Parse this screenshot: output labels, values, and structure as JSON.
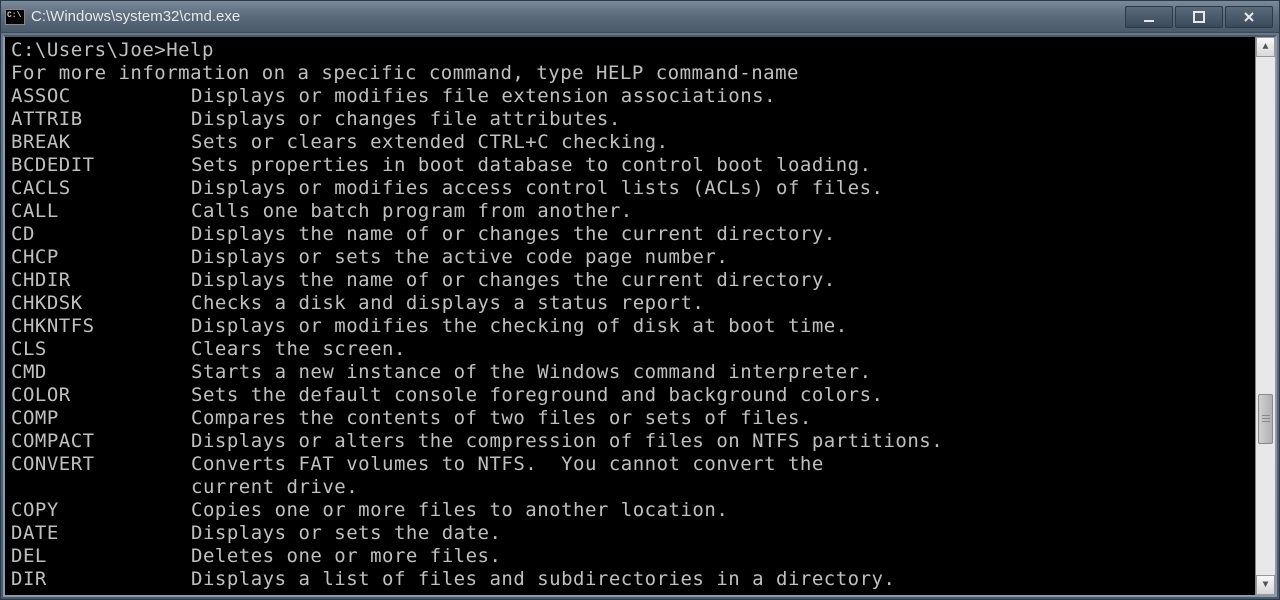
{
  "window": {
    "title": "C:\\Windows\\system32\\cmd.exe"
  },
  "console": {
    "prompt": "C:\\Users\\Joe>",
    "typed_command": "Help",
    "intro": "For more information on a specific command, type HELP command-name",
    "commands": [
      {
        "name": "ASSOC",
        "desc": "Displays or modifies file extension associations."
      },
      {
        "name": "ATTRIB",
        "desc": "Displays or changes file attributes."
      },
      {
        "name": "BREAK",
        "desc": "Sets or clears extended CTRL+C checking."
      },
      {
        "name": "BCDEDIT",
        "desc": "Sets properties in boot database to control boot loading."
      },
      {
        "name": "CACLS",
        "desc": "Displays or modifies access control lists (ACLs) of files."
      },
      {
        "name": "CALL",
        "desc": "Calls one batch program from another."
      },
      {
        "name": "CD",
        "desc": "Displays the name of or changes the current directory."
      },
      {
        "name": "CHCP",
        "desc": "Displays or sets the active code page number."
      },
      {
        "name": "CHDIR",
        "desc": "Displays the name of or changes the current directory."
      },
      {
        "name": "CHKDSK",
        "desc": "Checks a disk and displays a status report."
      },
      {
        "name": "CHKNTFS",
        "desc": "Displays or modifies the checking of disk at boot time."
      },
      {
        "name": "CLS",
        "desc": "Clears the screen."
      },
      {
        "name": "CMD",
        "desc": "Starts a new instance of the Windows command interpreter."
      },
      {
        "name": "COLOR",
        "desc": "Sets the default console foreground and background colors."
      },
      {
        "name": "COMP",
        "desc": "Compares the contents of two files or sets of files."
      },
      {
        "name": "COMPACT",
        "desc": "Displays or alters the compression of files on NTFS partitions."
      },
      {
        "name": "CONVERT",
        "desc": "Converts FAT volumes to NTFS.  You cannot convert the"
      },
      {
        "name": "",
        "desc": "current drive."
      },
      {
        "name": "COPY",
        "desc": "Copies one or more files to another location."
      },
      {
        "name": "DATE",
        "desc": "Displays or sets the date."
      },
      {
        "name": "DEL",
        "desc": "Deletes one or more files."
      },
      {
        "name": "DIR",
        "desc": "Displays a list of files and subdirectories in a directory."
      }
    ]
  }
}
